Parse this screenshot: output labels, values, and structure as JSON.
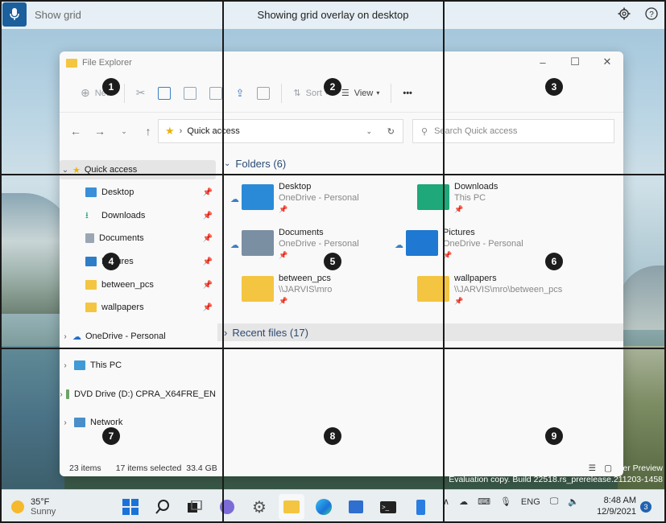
{
  "voice": {
    "command_hint": "Show grid",
    "status": "Showing grid overlay on desktop"
  },
  "explorer": {
    "title": "File Explorer",
    "toolbar": {
      "new": "New",
      "sort": "Sort",
      "view": "View",
      "more": "•••"
    },
    "address": {
      "location": "Quick access",
      "search_placeholder": "Search Quick access"
    },
    "sidebar": {
      "quick_access": "Quick access",
      "pinned": [
        "Desktop",
        "Downloads",
        "Documents",
        "Pictures",
        "between_pcs",
        "wallpapers"
      ],
      "onedrive": "OneDrive - Personal",
      "this_pc": "This PC",
      "dvd": "DVD Drive (D:) CPRA_X64FRE_EN",
      "network": "Network"
    },
    "folders_header": "Folders (6)",
    "folders": [
      {
        "name": "Desktop",
        "location": "OneDrive - Personal"
      },
      {
        "name": "Downloads",
        "location": "This PC"
      },
      {
        "name": "Documents",
        "location": "OneDrive - Personal"
      },
      {
        "name": "Pictures",
        "location": "OneDrive - Personal"
      },
      {
        "name": "between_pcs",
        "location": "\\\\JARVIS\\mro"
      },
      {
        "name": "wallpapers",
        "location": "\\\\JARVIS\\mro\\between_pcs"
      }
    ],
    "recent_header": "Recent files (17)",
    "status": {
      "items": "23 items",
      "selected": "17 items selected  33.4 GB"
    }
  },
  "desktop": {
    "eval_line1": "er Preview",
    "eval_line2": "Evaluation copy. Build 22518.rs_prerelease.211203-1458"
  },
  "taskbar": {
    "weather_temp": "35°F",
    "weather_desc": "Sunny",
    "language": "ENG",
    "time": "8:48 AM",
    "date": "12/9/2021",
    "notification_count": "3"
  },
  "grid": {
    "labels": [
      "1",
      "2",
      "3",
      "4",
      "5",
      "6",
      "7",
      "8",
      "9"
    ]
  },
  "colors": {
    "accent": "#1b5f9c",
    "folder": "#f4c540",
    "overlay": "#1a1a1a"
  }
}
